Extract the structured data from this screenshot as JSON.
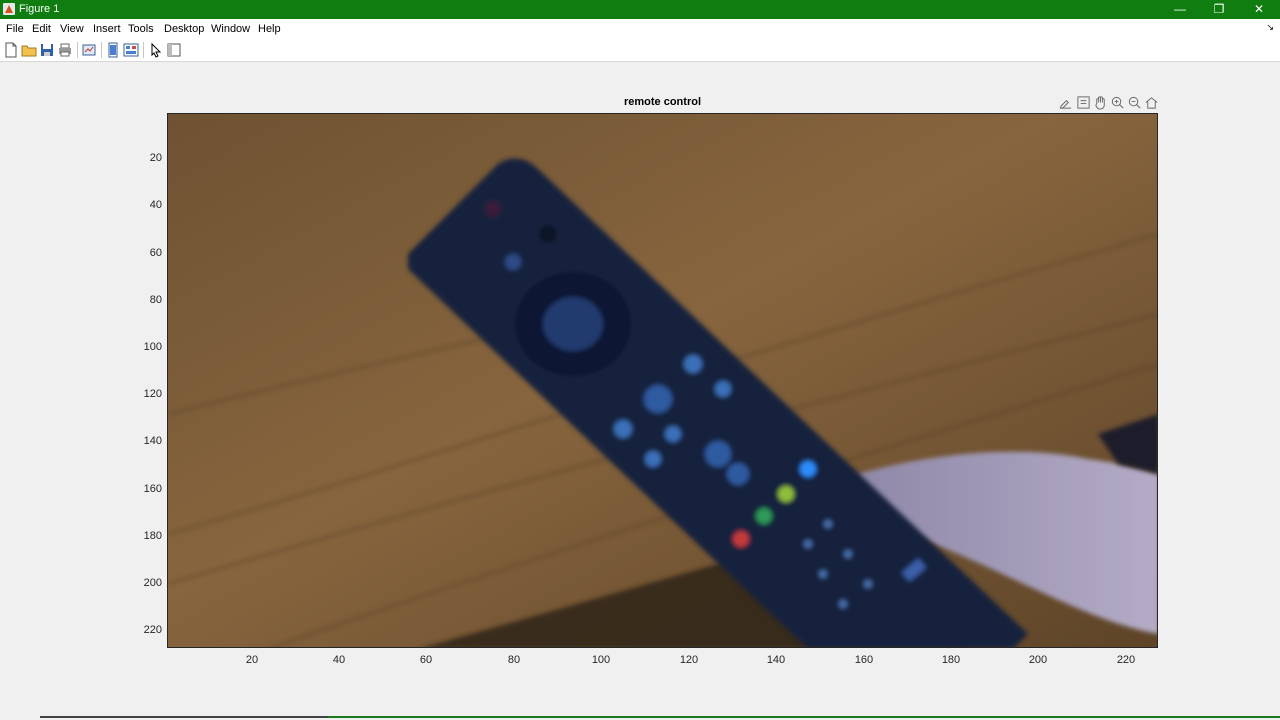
{
  "window": {
    "title": "Figure 1"
  },
  "menu": [
    "File",
    "Edit",
    "View",
    "Insert",
    "Tools",
    "Desktop",
    "Window",
    "Help"
  ],
  "toolbar_icons": [
    "new-figure-icon",
    "open-file-icon",
    "save-icon",
    "print-icon",
    "link-plot-icon",
    "hide-tools-icon",
    "property-editor-icon",
    "edit-plot-arrow-icon",
    "plot-browser-icon"
  ],
  "axes_toolbar_icons": [
    "brush-icon",
    "data-tips-icon",
    "pan-hand-icon",
    "zoom-in-icon",
    "zoom-out-icon",
    "restore-view-icon"
  ],
  "figure": {
    "title": "remote control",
    "image": "blurred webcam photo of a dark blue TV remote control held diagonally by a hand over a wooden surface"
  },
  "axes": {
    "yticks": [
      "20",
      "40",
      "60",
      "80",
      "100",
      "120",
      "140",
      "160",
      "180",
      "200",
      "220"
    ],
    "xticks": [
      "20",
      "40",
      "60",
      "80",
      "100",
      "120",
      "140",
      "160",
      "180",
      "200",
      "220"
    ]
  },
  "colors": {
    "titlebar": "#0f7d0f",
    "remote": "#1c2a4a",
    "wood": "#7a5a36"
  }
}
